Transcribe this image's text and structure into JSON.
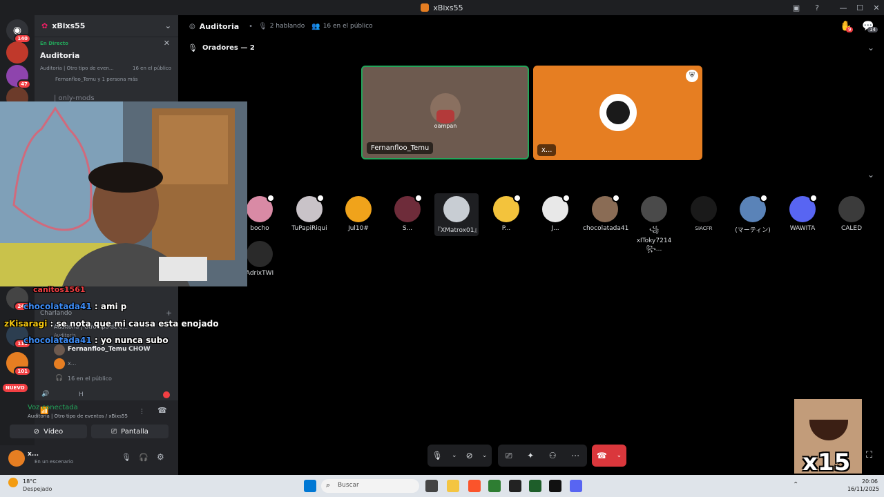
{
  "window": {
    "title": "xBixs55"
  },
  "server": {
    "name": "xBixs55"
  },
  "event": {
    "live_label": "En Directo",
    "title": "Auditoria",
    "meta": "Auditoria | Otro tipo de even...",
    "listeners": "16 en el público",
    "people": "Fernanfloo_Temu y 1 persona más"
  },
  "channels": {
    "only_mods": "| only-mods",
    "charlando": "Charlando",
    "auditoria_row": "Auditoria | Otro tipo de e...",
    "auditoria_sub": "Auditoria",
    "speaker_name": "Fernanfloo_Temu",
    "speaker_tag": "CHOW",
    "speaker2": "x...",
    "public": "16 en el público",
    "last_row": "H"
  },
  "rail_badges": [
    "140",
    "47",
    "247",
    "110",
    "101"
  ],
  "rail_new": "NUEVO",
  "voice": {
    "status": "Voz conectada",
    "detail": "Auditoria | Otro tipo de eventos / xBixs55",
    "video_label": "Vídeo",
    "screen_label": "Pantalla",
    "user_name": "x...",
    "user_status": "En un escenario"
  },
  "stage": {
    "channel": "Auditoria",
    "speaking": "2 hablando",
    "public": "16 en el público",
    "speakers_header": "Oradores — 2",
    "notif_count_1": "9",
    "notif_count_2": "14"
  },
  "speakers": [
    {
      "name": "Fernanfloo_Temu",
      "avatar_text": "oampan",
      "color": "#6d5a4f"
    },
    {
      "name": "x...",
      "color": "#e67e22"
    }
  ],
  "audience_row1": [
    {
      "name": "bocho",
      "color": "#d98aa5"
    },
    {
      "name": "TuPapiRiqui",
      "color": "#c9c3c8"
    },
    {
      "name": "Jul10#",
      "color": "#f0a31b"
    },
    {
      "name": "S...",
      "color": "#6e2c3a"
    },
    {
      "name": "『XMatrox01』",
      "color": "#c8cdd3"
    },
    {
      "name": "P...",
      "color": "#f3c33c"
    },
    {
      "name": "J...",
      "color": "#e8e8e8"
    },
    {
      "name": "chocolatada41",
      "color": "#8a6c55"
    },
    {
      "name": "꧁xIToky7214꧂...",
      "color": "#4a4a4a"
    },
    {
      "name": "SIACFR",
      "color": "#1a1a1a"
    },
    {
      "name": "(マーティン)",
      "color": "#5a83b8"
    },
    {
      "name": "WAWITA",
      "color": "#5865f2"
    },
    {
      "name": "CALED",
      "color": "#3b3b3b"
    }
  ],
  "audience_row2": [
    {
      "name": "AdrixTWI",
      "color": "#2a2a2a"
    }
  ],
  "chat": [
    {
      "user": "canitos1561",
      "text": "",
      "color": "#f23f43"
    },
    {
      "user": "chocolatada41",
      "text": " : ami p",
      "color": "#3d8cf5"
    },
    {
      "user": "zKisaragi",
      "text": " : se nota que mi causa esta enojado",
      "color": "#f1c40f"
    },
    {
      "user": "chocolatada41",
      "text": " : yo nunca subo",
      "color": "#3d8cf5"
    }
  ],
  "reaction": {
    "label": "x15"
  },
  "taskbar": {
    "weather_temp": "18°C",
    "weather_desc": "Despejado",
    "search_placeholder": "Buscar",
    "time": "20:06",
    "date": "16/11/2025"
  }
}
